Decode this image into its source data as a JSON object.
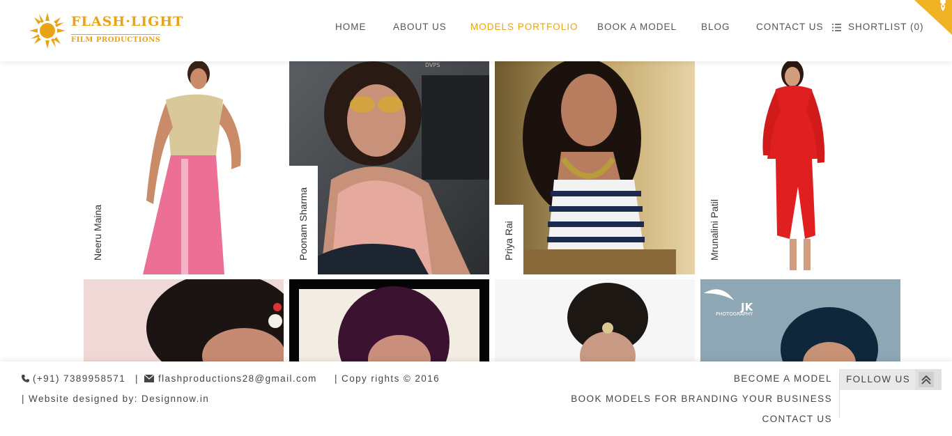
{
  "brand": {
    "title": "FLASH·LIGHT",
    "subtitle": "FILM PRODUCTIONS",
    "accent_color": "#e8a317"
  },
  "nav": {
    "items": [
      {
        "label": "HOME",
        "active": false
      },
      {
        "label": "ABOUT US",
        "active": false
      },
      {
        "label": "MODELS PORTFOLIO",
        "active": true
      },
      {
        "label": "BOOK A MODEL",
        "active": false
      },
      {
        "label": "BLOG",
        "active": false
      },
      {
        "label": "CONTACT US",
        "active": false
      }
    ],
    "shortlist_label": "SHORTLIST (0)",
    "shortlist_icon": "list-icon",
    "corner_icon": "location-pin-icon"
  },
  "models": [
    {
      "name": "Neeru Maina"
    },
    {
      "name": "Poonam Sharma"
    },
    {
      "name": "Priya Rai"
    },
    {
      "name": "Mrunalini Patil"
    },
    {
      "name": ""
    },
    {
      "name": ""
    },
    {
      "name": ""
    },
    {
      "name": ""
    }
  ],
  "photo_overlays": {
    "tile2_watermark": "DVPS",
    "tile8_watermark_big": "JK",
    "tile8_watermark_small": "PHOTOGRAPHY"
  },
  "footer": {
    "phone": "(+91) 7389958571",
    "separator1": "|",
    "email": "flashproductions28@gmail.com",
    "copyright": "| Copy rights © 2016",
    "designed_by": "| Website designed by: Designnow.in",
    "links": [
      "BECOME A MODEL",
      "BOOK MODELS FOR BRANDING YOUR BUSINESS",
      "CONTACT US"
    ],
    "follow_label": "FOLLOW US",
    "follow_icon": "chevron-double-up-icon"
  }
}
